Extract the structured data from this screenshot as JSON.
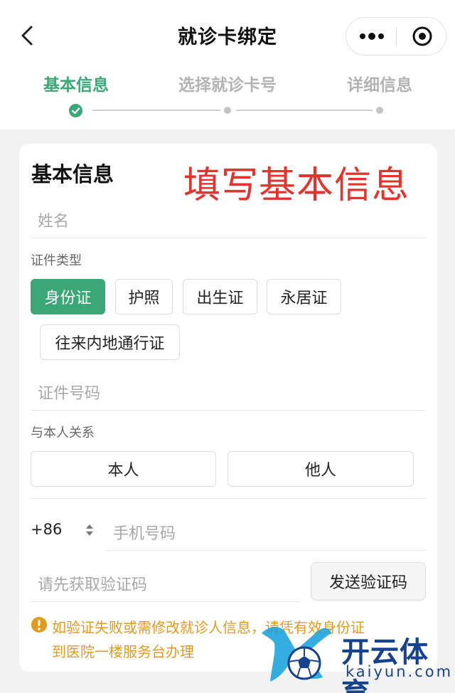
{
  "nav": {
    "title": "就诊卡绑定",
    "back_icon": "chevron-left-icon",
    "more_icon": "more-dots-icon",
    "close_icon": "target-icon"
  },
  "steps": [
    {
      "label": "基本信息",
      "state": "completed"
    },
    {
      "label": "选择就诊卡号",
      "state": "pending"
    },
    {
      "label": "详细信息",
      "state": "pending"
    }
  ],
  "form": {
    "section_title": "基本信息",
    "annotation": "填写基本信息",
    "name_placeholder": "姓名",
    "id_type_label": "证件类型",
    "id_types": [
      "身份证",
      "护照",
      "出生证",
      "永居证",
      "往来内地通行证"
    ],
    "id_type_selected": "身份证",
    "id_number_placeholder": "证件号码",
    "relation_label": "与本人关系",
    "relations": [
      "本人",
      "他人"
    ],
    "country_code": "+86",
    "phone_placeholder": "手机号码",
    "verify_placeholder": "请先获取验证码",
    "send_code_label": "发送验证码"
  },
  "notice": {
    "line1": "如验证失败或需修改就诊人信息，请凭有效身份证",
    "line2": "到医院一楼服务台办理"
  },
  "watermark": {
    "brand": "开云体育",
    "domain": "kaiyun.com"
  },
  "colors": {
    "accent": "#3aa776",
    "annotation_red": "#e5322d",
    "warning": "#e39a1c",
    "watermark_blue": "#17438e"
  }
}
